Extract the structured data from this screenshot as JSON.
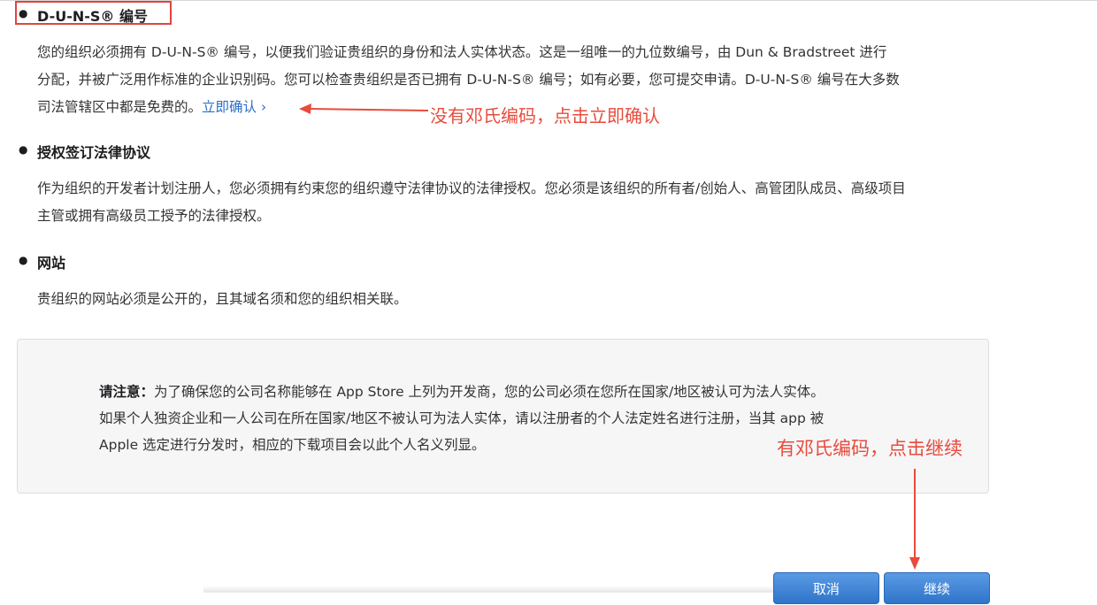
{
  "sections": {
    "duns": {
      "title": "D-U-N-S® 编号",
      "lines": [
        "您的组织必须拥有 D-U-N-S® 编号，以便我们验证贵组织的身份和法人实体状态。这是一组唯一的九位数编号，由 Dun & Bradstreet 进行",
        "分配，并被广泛用作标准的企业识别码。您可以检查贵组织是否已拥有 D-U-N-S® 编号；如有必要，您可提交申请。D-U-N-S® 编号在大多数",
        "司法管辖区中都是免费的。"
      ],
      "link_label": "立即确认 ›"
    },
    "legal": {
      "title": "授权签订法律协议",
      "lines": [
        "作为组织的开发者计划注册人，您必须拥有约束您的组织遵守法律协议的法律授权。您必须是该组织的所有者/创始人、高管团队成员、高级项目",
        "主管或拥有高级员工授予的法律授权。"
      ]
    },
    "website": {
      "title": "网站",
      "lines": [
        "贵组织的网站必须是公开的，且其域名须和您的组织相关联。"
      ]
    }
  },
  "note": {
    "label": "请注意：",
    "lines": [
      "为了确保您的公司名称能够在 App Store 上列为开发商，您的公司必须在您所在国家/地区被认可为法人实体。",
      "如果个人独资企业和一人公司在所在国家/地区不被认可为法人实体，请以注册者的个人法定姓名进行注册，当其 app 被",
      "Apple 选定进行分发时，相应的下载项目会以此个人名义列显。"
    ]
  },
  "annotations": {
    "no_duns": "没有邓氏编码，点击立即确认",
    "has_duns": "有邓氏编码，点击继续"
  },
  "buttons": {
    "cancel": "取消",
    "continue": "继续"
  },
  "colors": {
    "annotation_red": "#e84b3c",
    "link_blue": "#2a6fc9",
    "button_blue": "#3a7fd2"
  }
}
